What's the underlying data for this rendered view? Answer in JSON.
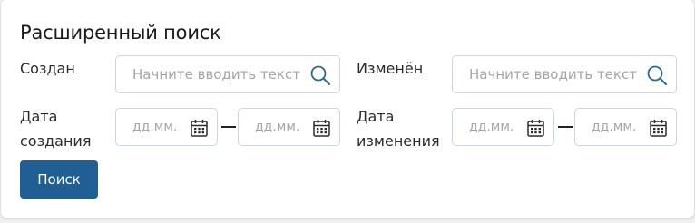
{
  "title": "Расширенный поиск",
  "created": {
    "label": "Создан",
    "placeholder": "Начните вводить текст"
  },
  "modified": {
    "label": "Изменён",
    "placeholder": "Начните вводить текст"
  },
  "created_date": {
    "label_line1": "Дата",
    "label_line2": "создания",
    "from_placeholder": "дд.мм.",
    "to_placeholder": "дд.мм."
  },
  "modified_date": {
    "label_line1": "Дата",
    "label_line2": "изменения",
    "from_placeholder": "дд.мм.",
    "to_placeholder": "дд.мм."
  },
  "search_button": "Поиск",
  "colors": {
    "accent": "#1f5f93",
    "icon": "#2a6a96",
    "border": "#cfd6dd"
  },
  "icons": {
    "search": "search-icon",
    "calendar": "calendar-icon"
  }
}
